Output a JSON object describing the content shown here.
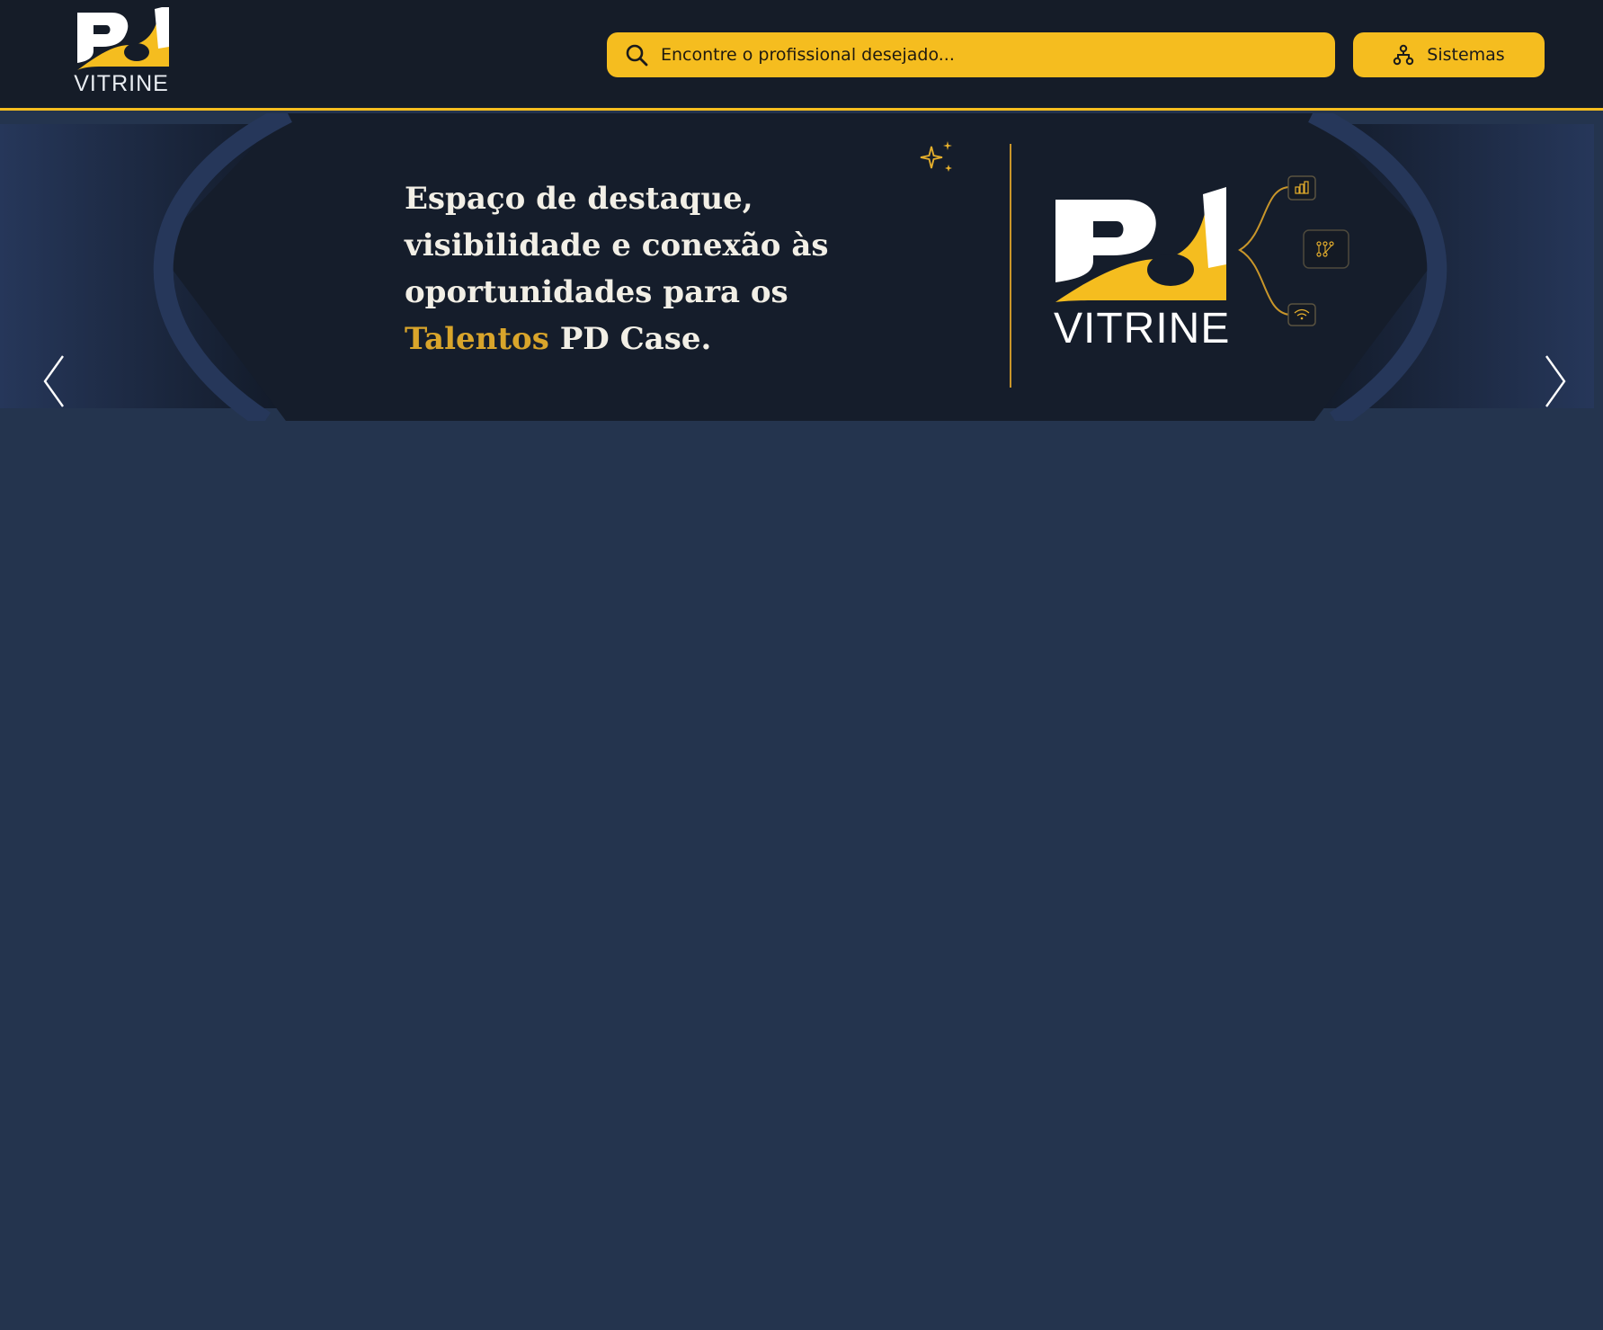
{
  "brand": {
    "logo_word": "VITRINE",
    "colors": {
      "accent": "#f5bd1f",
      "header_bg": "#151c28",
      "page_bg": "#24344e"
    }
  },
  "header": {
    "search": {
      "placeholder": "Encontre o profissional desejado...",
      "icon": "search-icon"
    },
    "systems_button": {
      "label": "Sistemas",
      "icon": "sitemap-icon"
    }
  },
  "banner": {
    "headline_part1": "Espaço de destaque, visibilidade e conexão às oportunidades para os",
    "headline_accent": "Talentos",
    "headline_part2": "PD Case.",
    "logo_word": "VITRINE",
    "branch_icons": [
      "bar-chart-icon",
      "graph-nodes-icon",
      "wifi-icon"
    ],
    "prev_icon": "chevron-left-icon",
    "next_icon": "chevron-right-icon"
  }
}
